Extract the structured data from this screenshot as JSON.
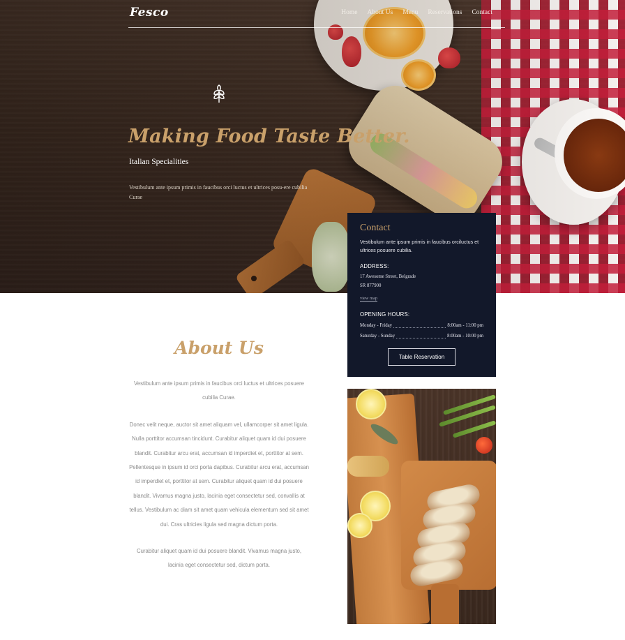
{
  "nav": {
    "logo": "Fesco",
    "items": [
      "Home",
      "About Us",
      "Menu",
      "Reservations",
      "Contact"
    ]
  },
  "hero": {
    "icon": "wheat-icon",
    "title": "Making Food Taste Better.",
    "subtitle": "Italian Specialities",
    "text": "Vestibulum ante ipsum primis in faucibus orci luctus et ultrices posu-ere cubilia Curae"
  },
  "contact": {
    "title": "Contact",
    "intro": "Vestibulum ante ipsum primis in faucibus orciluctus et ultrices posuere cubilia.",
    "address_label": "ADDRESS:",
    "address_line1": "17 Awesome Street, Belgrade",
    "address_line2": "SR 877900",
    "view_map": "view map",
    "hours_label": "OPENING HOURS:",
    "hours": [
      {
        "days": "Monday - Friday",
        "time": "8:00am - 11:00 pm"
      },
      {
        "days": "Saturday - Sunday",
        "time": "8:00am - 10:00 pm"
      }
    ],
    "button": "Table Reservation"
  },
  "about": {
    "title": "About Us",
    "p1": "Vestibulum ante ipsum primis in faucibus orci luctus et ultrices posuere cubilia Curae.",
    "p2": "Donec velit neque, auctor sit amet aliquam vel, ullamcorper sit amet ligula. Nulla porttitor accumsan tincidunt. Curabitur aliquet quam id dui posuere blandit. Curabitur arcu erat, accumsan id imperdiet et, porttitor at sem. Pellentesque in ipsum id orci porta dapibus. Curabitur arcu erat, accumsan id imperdiet et, porttitor at sem. Curabitur aliquet quam id dui posuere blandit. Vivamus magna justo, lacinia eget consectetur sed, convallis at tellus. Vestibulum ac diam sit amet quam vehicula elementum sed sit amet dui. Cras ultricies ligula sed magna dictum porta.",
    "p3": "Curabitur aliquet quam id dui posuere blandit. Vivamus magna justo, lacinia eget consectetur sed, dictum porta."
  },
  "colors": {
    "accent_gold": "#c9a06a",
    "contact_bg": "#12182a",
    "body_text": "#8a8a8a"
  }
}
